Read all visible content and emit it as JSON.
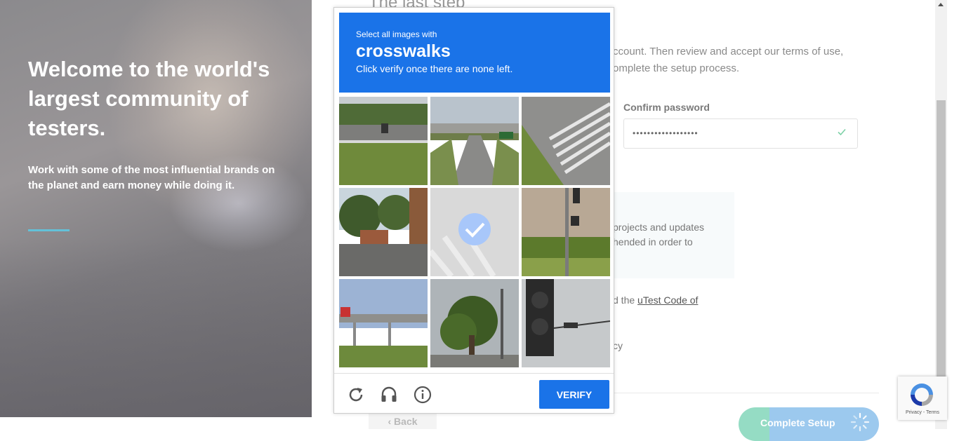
{
  "hero": {
    "title": "Welcome to the world's largest community of testers.",
    "subtitle": "Work with some of the most influential brands on the planet and earn money while doing it.",
    "accent_color": "#63c1d9"
  },
  "form": {
    "title": "The last step",
    "description": "ccount. Then review and accept our terms of use, omplete the setup process.",
    "confirm_password": {
      "label": "Confirm password",
      "value": "••••••••••••••••••",
      "valid": true
    },
    "info_text": "projects and updates hended in order to",
    "terms_prefix": "d the ",
    "terms_link": "uTest Code of",
    "privacy_fragment": "cy",
    "back_button": "Back",
    "complete_button": "Complete Setup"
  },
  "recaptcha_badge": {
    "links": "Privacy - Terms"
  },
  "captcha": {
    "instruction_small": "Select all images with",
    "target": "crosswalks",
    "instruction_bottom": "Click verify once there are none left.",
    "header_color": "#1a73e8",
    "tiles": [
      {
        "scene": "motorcycle-highway",
        "selected": false
      },
      {
        "scene": "highway-overpass",
        "selected": false
      },
      {
        "scene": "crosswalk-road",
        "selected": false
      },
      {
        "scene": "street-trees",
        "selected": false
      },
      {
        "scene": "crosswalk-faded",
        "selected": true
      },
      {
        "scene": "traffic-light-building",
        "selected": false
      },
      {
        "scene": "elevated-train",
        "selected": false
      },
      {
        "scene": "tree-street-light",
        "selected": false
      },
      {
        "scene": "traffic-light-closeup",
        "selected": false
      }
    ],
    "icons": [
      "reload-icon",
      "audio-icon",
      "info-icon"
    ],
    "verify_label": "VERIFY"
  }
}
